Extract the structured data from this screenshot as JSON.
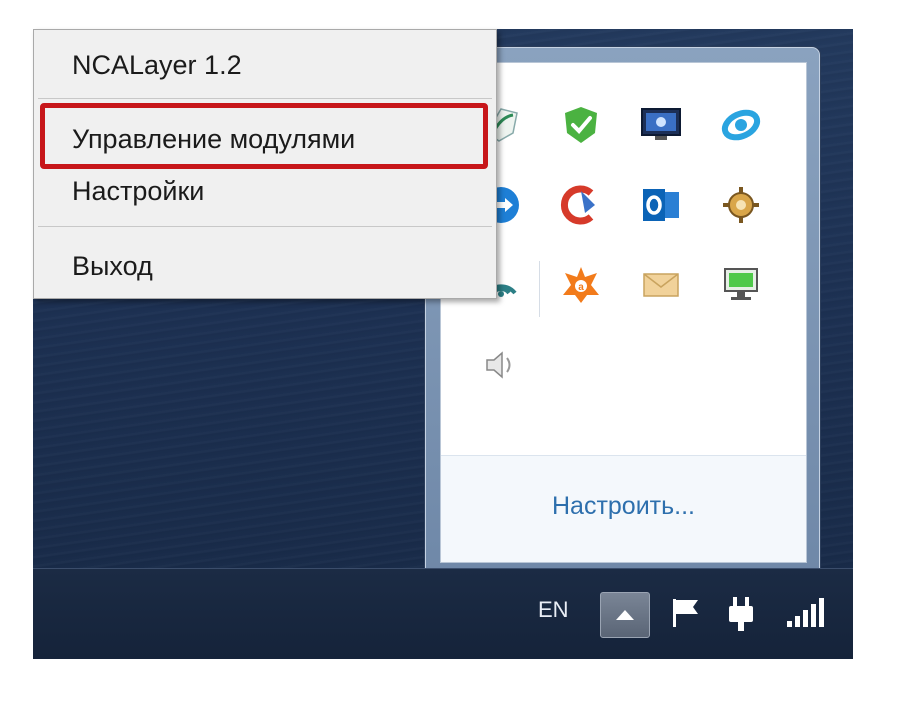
{
  "context_menu": {
    "title": "NCALayer 1.2",
    "items": [
      "Управление модулями",
      "Настройки",
      "Выход"
    ]
  },
  "overflow_panel": {
    "customize_link": "Настроить...",
    "icons": [
      "kz-leaf-icon",
      "check-shield-icon",
      "monitor-network-icon",
      "refresh-arrows-icon",
      "teamviewer-icon",
      "ccleaner-icon",
      "outlook-icon",
      "gear-sun-icon",
      "wifi-signal-icon",
      "avast-icon",
      "mail-envelope-icon",
      "network-monitor-icon",
      "speaker-icon"
    ]
  },
  "taskbar": {
    "language": "EN",
    "icons": [
      "show-hidden-icons-button",
      "action-center-flag-icon",
      "power-plug-icon",
      "signal-bars-icon"
    ]
  },
  "colors": {
    "highlight_border": "#c7161a",
    "link": "#2d6fad",
    "menu_bg": "#f0f0f0"
  }
}
